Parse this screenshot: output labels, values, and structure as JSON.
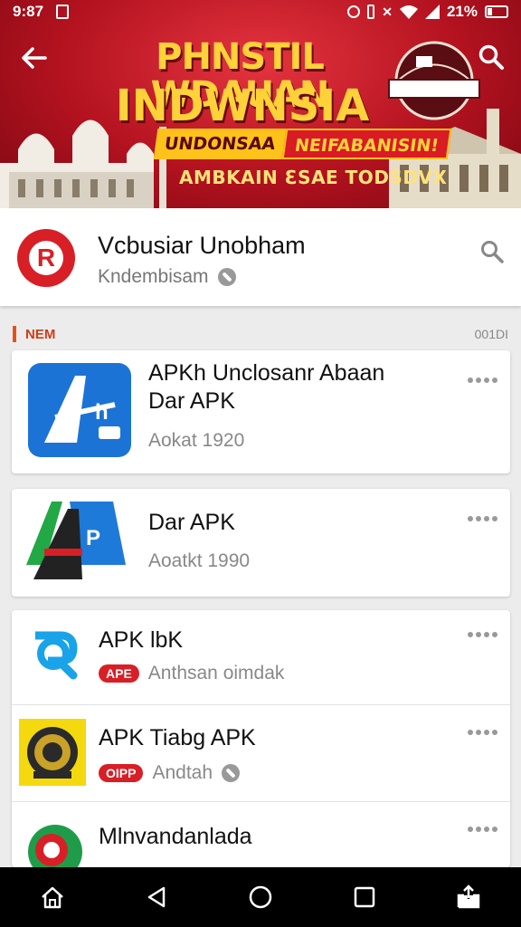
{
  "status_bar": {
    "time": "9:87",
    "battery": "21%"
  },
  "banner": {
    "line1": "PHNSTIL WDAUAN",
    "line2": "INDWNSIA",
    "ribbon_left": "UNDONSAA",
    "ribbon_right": "NEIFABANISIN!",
    "line3": "AMBKAIN ƐSAE TODSDVX"
  },
  "header": {
    "title": "Vcbusiar Unobham",
    "subtitle": "Kndembisam",
    "logo_letter": "R"
  },
  "section": {
    "label": "NEM",
    "count": "001DI"
  },
  "apps": [
    {
      "title_line1": "APKh Unclosanr Abaan",
      "title_line2": "Dar APK",
      "subtitle": "Aokat 1920"
    },
    {
      "title": "Dar APK",
      "subtitle": "Aoatkt 1990"
    },
    {
      "title": "APK lbK",
      "badge": "APE",
      "subtitle": "Anthsan oimdak"
    },
    {
      "title": "APK Tiabg APK",
      "badge": "OIPP",
      "subtitle": "Andtah"
    },
    {
      "title": "Mlnvandanlada"
    }
  ],
  "colors": {
    "banner_red": "#b3121f",
    "accent_red": "#d81f26",
    "banner_gold": "#ffd23a",
    "section_orange": "#e5521b"
  }
}
